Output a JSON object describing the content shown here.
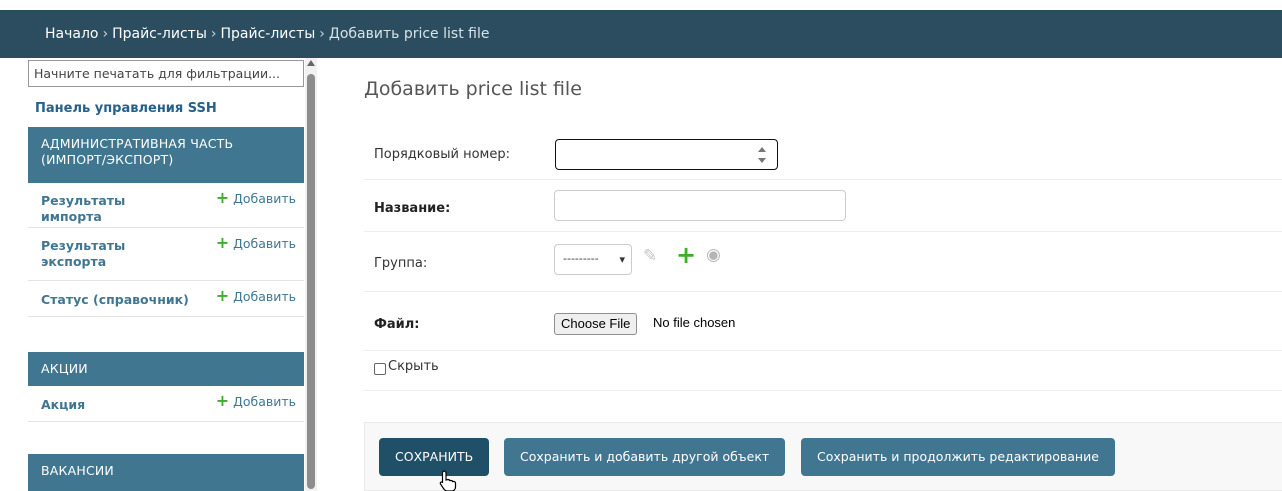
{
  "breadcrumbs": {
    "home": "Начало",
    "app": "Прайс-листы",
    "model": "Прайс-листы",
    "current": "Добавить price list file",
    "separator": "›"
  },
  "sidebar": {
    "filter_placeholder": "Начните печатать для фильтрации...",
    "ssh_link": "Панель управления SSH",
    "sections": [
      {
        "title": "АДМИНИСТРАТИВНАЯ ЧАСТЬ (ИМПОРТ/ЭКСПОРТ)",
        "items": [
          {
            "name": "Результаты импорта",
            "add": "Добавить"
          },
          {
            "name": "Результаты экспорта",
            "add": "Добавить"
          },
          {
            "name": "Статус (справочник)",
            "add": "Добавить"
          }
        ]
      },
      {
        "title": "АКЦИИ",
        "items": [
          {
            "name": "Акция",
            "add": "Добавить"
          }
        ]
      },
      {
        "title": "ВАКАНСИИ",
        "items": []
      }
    ]
  },
  "main": {
    "title": "Добавить price list file",
    "fields": {
      "order_label": "Порядковый номер:",
      "order_value": "",
      "name_label": "Название:",
      "name_value": "",
      "group_label": "Группа:",
      "group_selected": "---------",
      "file_label": "Файл:",
      "file_button": "Choose File",
      "file_status": "No file chosen",
      "hide_label": "Скрыть",
      "hide_checked": false
    },
    "buttons": {
      "save": "СОХРАНИТЬ",
      "save_add": "Сохранить и добавить другой объект",
      "save_continue": "Сохранить и продолжить редактирование"
    }
  },
  "colors": {
    "header_bg": "#2b4d5f",
    "section_bg": "#417690",
    "primary_button": "#417690",
    "default_button": "#205067",
    "add_green": "#3fae2a"
  },
  "icons": {
    "add": "plus-icon",
    "edit": "pencil-icon",
    "view": "eye-icon",
    "select": "chevron-down-icon"
  }
}
